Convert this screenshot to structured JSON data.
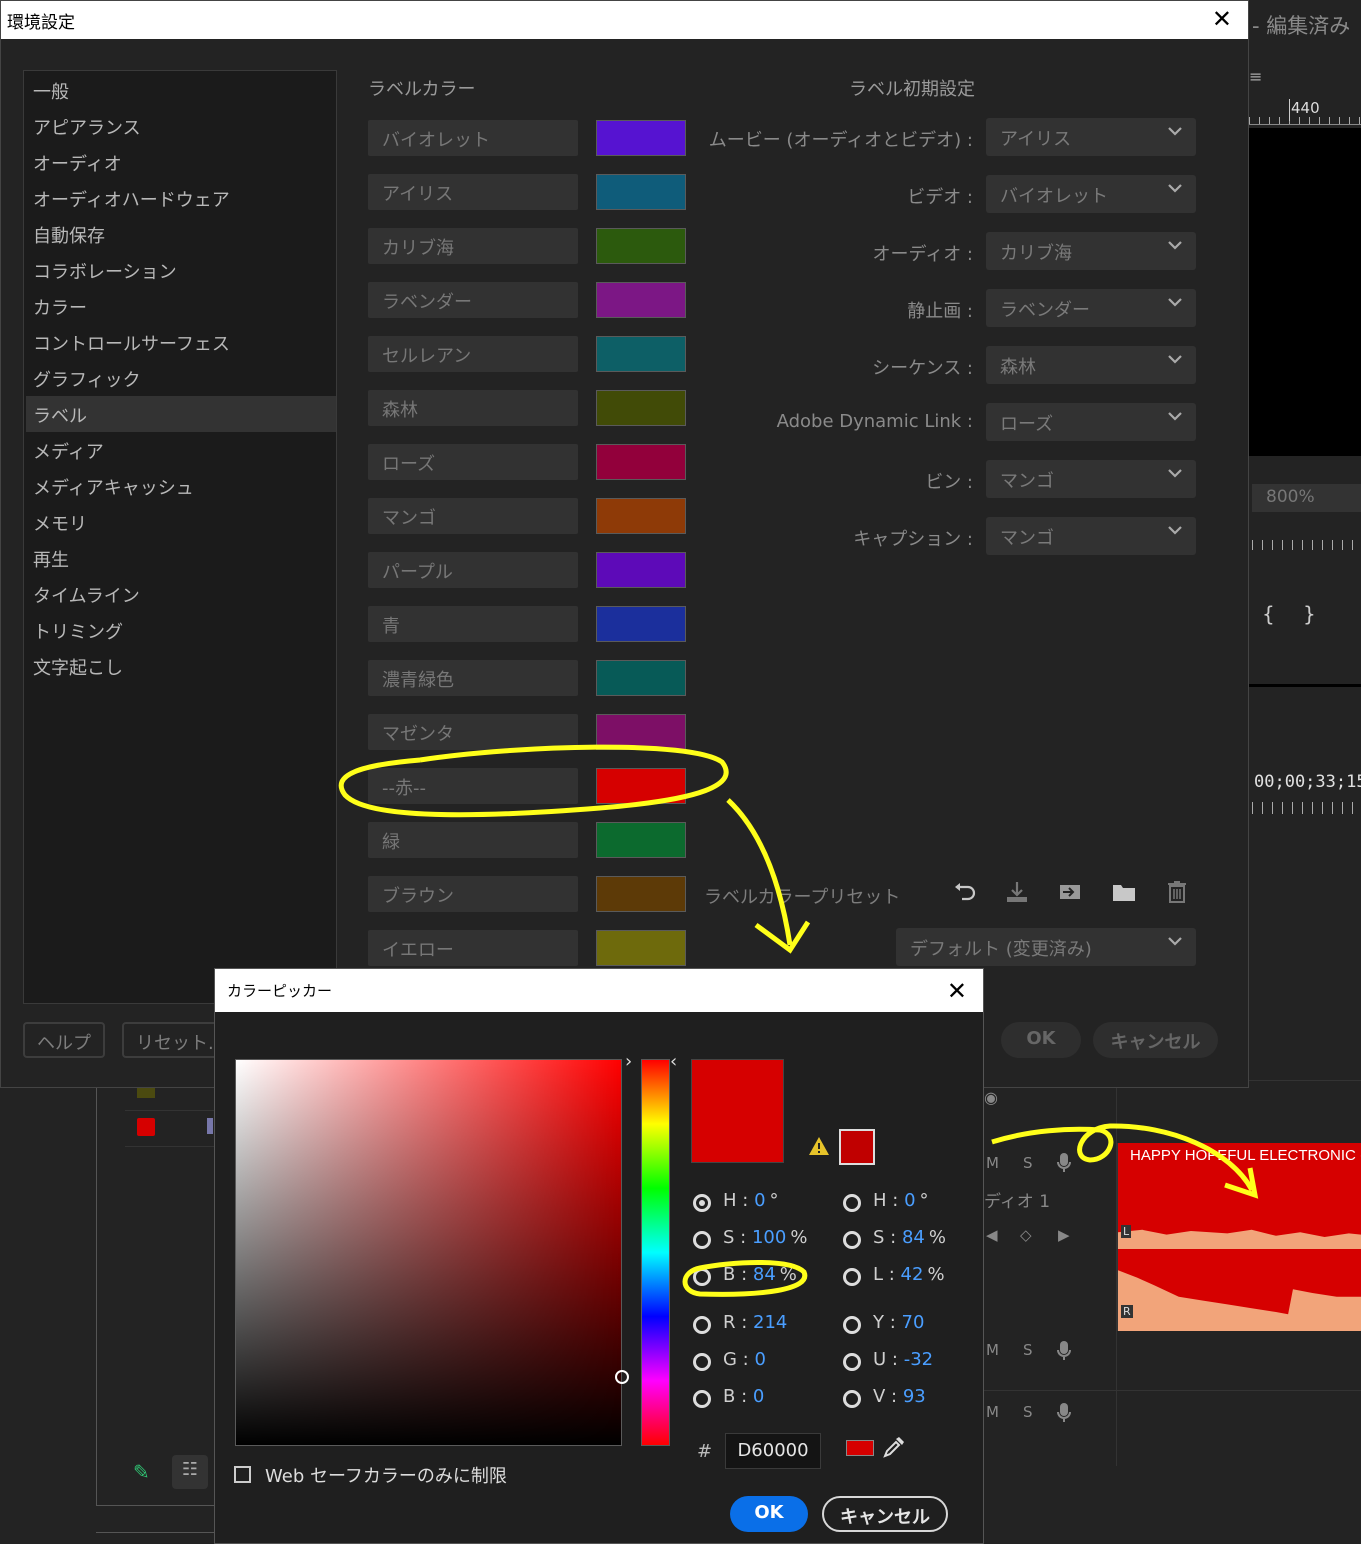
{
  "background_app": {
    "title": "- 編集済み",
    "ruler_value": "440",
    "zoom": "800%",
    "timecode": "00;00;33;15",
    "track_controls": [
      "M",
      "S"
    ],
    "track_name": "ディオ 1",
    "clip_title": "HAPPY HOPEFUL ELECTRONIC (",
    "channel_left": "L",
    "channel_right": "R"
  },
  "preferences": {
    "title": "環境設定",
    "sidebar": [
      {
        "label": "一般"
      },
      {
        "label": "アピアランス"
      },
      {
        "label": "オーディオ"
      },
      {
        "label": "オーディオハードウェア"
      },
      {
        "label": "自動保存"
      },
      {
        "label": "コラボレーション"
      },
      {
        "label": "カラー"
      },
      {
        "label": "コントロールサーフェス"
      },
      {
        "label": "グラフィック"
      },
      {
        "label": "ラベル",
        "selected": true
      },
      {
        "label": "メディア"
      },
      {
        "label": "メディアキャッシュ"
      },
      {
        "label": "メモリ"
      },
      {
        "label": "再生"
      },
      {
        "label": "タイムライン"
      },
      {
        "label": "トリミング"
      },
      {
        "label": "文字起こし"
      }
    ],
    "label_colors_heading": "ラベルカラー",
    "label_colors": [
      {
        "name": "バイオレット",
        "color": "#5613d1"
      },
      {
        "name": "アイリス",
        "color": "#0f5c7a"
      },
      {
        "name": "カリブ海",
        "color": "#2c5a0d"
      },
      {
        "name": "ラベンダー",
        "color": "#7c1785"
      },
      {
        "name": "セルレアン",
        "color": "#0d5f66"
      },
      {
        "name": "森林",
        "color": "#414b07"
      },
      {
        "name": "ローズ",
        "color": "#92003b"
      },
      {
        "name": "マンゴ",
        "color": "#8e3a07"
      },
      {
        "name": "パープル",
        "color": "#5d0ab8"
      },
      {
        "name": "青",
        "color": "#1b2f9c"
      },
      {
        "name": "濃青緑色",
        "color": "#075a57"
      },
      {
        "name": "マゼンタ",
        "color": "#7d0f66"
      },
      {
        "name": "--赤--",
        "color": "#d60000"
      },
      {
        "name": "緑",
        "color": "#0c6a2e"
      },
      {
        "name": "ブラウン",
        "color": "#5d3a07"
      },
      {
        "name": "イエロー",
        "color": "#6e6a0c"
      }
    ],
    "label_defaults_heading": "ラベル初期設定",
    "label_defaults": [
      {
        "label": "ムービー (オーディオとビデオ) :",
        "value": "アイリス"
      },
      {
        "label": "ビデオ :",
        "value": "バイオレット"
      },
      {
        "label": "オーディオ :",
        "value": "カリブ海"
      },
      {
        "label": "静止画 :",
        "value": "ラベンダー"
      },
      {
        "label": "シーケンス :",
        "value": "森林"
      },
      {
        "label": "Adobe Dynamic Link :",
        "value": "ローズ"
      },
      {
        "label": "ビン :",
        "value": "マンゴ"
      },
      {
        "label": "キャプション :",
        "value": "マンゴ"
      }
    ],
    "preset_label": "ラベルカラープリセット",
    "preset_value": "デフォルト (変更済み)",
    "help_label": "ヘルプ",
    "reset_label": "リセット...",
    "ok_label": "OK",
    "cancel_label": "キャンセル"
  },
  "color_picker": {
    "title": "カラーピッカー",
    "current_color": "#d60000",
    "web_safe_color": "#c00000",
    "hsb": [
      {
        "key": "H",
        "value": "0",
        "unit": "°",
        "selected": true
      },
      {
        "key": "S",
        "value": "100",
        "unit": "%"
      },
      {
        "key": "B",
        "value": "84",
        "unit": "%"
      }
    ],
    "hsl": [
      {
        "key": "H",
        "value": "0",
        "unit": "°"
      },
      {
        "key": "S",
        "value": "84",
        "unit": "%"
      },
      {
        "key": "L",
        "value": "42",
        "unit": "%"
      }
    ],
    "rgb": [
      {
        "key": "R",
        "value": "214"
      },
      {
        "key": "G",
        "value": "0"
      },
      {
        "key": "B",
        "value": "0"
      }
    ],
    "yuv": [
      {
        "key": "Y",
        "value": "70"
      },
      {
        "key": "U",
        "value": "-32"
      },
      {
        "key": "V",
        "value": "93"
      }
    ],
    "hash": "#",
    "hex": "D60000",
    "web_safe_label": "Web セーフカラーのみに制限",
    "ok_label": "OK",
    "cancel_label": "キャンセル"
  },
  "icons": [
    "close-icon",
    "chevron-down-icon",
    "undo-icon",
    "download-icon",
    "import-icon",
    "folder-icon",
    "trash-icon",
    "warning-icon",
    "eyedropper-icon",
    "pen-icon",
    "list-icon",
    "microphone-icon"
  ]
}
